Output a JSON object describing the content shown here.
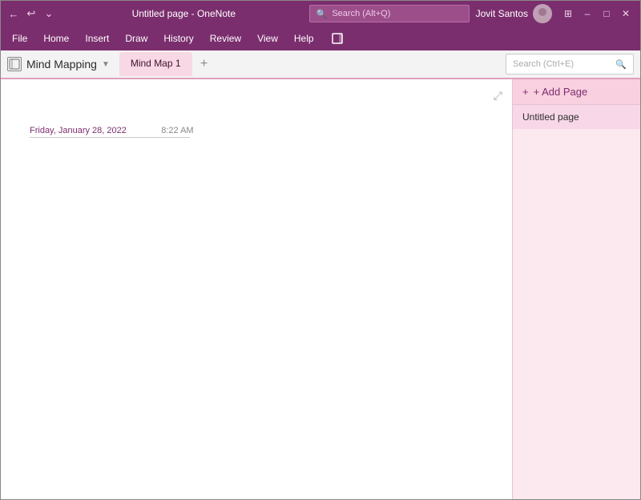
{
  "titlebar": {
    "title": "Untitled page - OneNote",
    "search_placeholder": "Search (Alt+Q)",
    "search_icon": "🔍",
    "user_name": "Jovit Santos",
    "controls": {
      "back": "←",
      "undo": "↩",
      "more": "⌄",
      "minimize": "─",
      "restore": "□",
      "close": "✕",
      "collapse_icon": "⊞"
    }
  },
  "menu": {
    "items": [
      "File",
      "Home",
      "Insert",
      "Draw",
      "History",
      "Review",
      "View",
      "Help"
    ]
  },
  "tabs": {
    "notebook_label": "Mind Mapping",
    "notebook_icon": "☐",
    "active_tab": "Mind Map 1",
    "add_tab_icon": "+",
    "search_placeholder": "Search (Ctrl+E)",
    "search_icon": "🔍"
  },
  "page": {
    "date": "Friday, January 28, 2022",
    "time": "8:22 AM",
    "expand_icon": "⤢"
  },
  "sidebar": {
    "add_page_label": "+ Add Page",
    "add_icon": "+",
    "pages": [
      {
        "title": "Untitled page",
        "selected": true
      }
    ]
  }
}
